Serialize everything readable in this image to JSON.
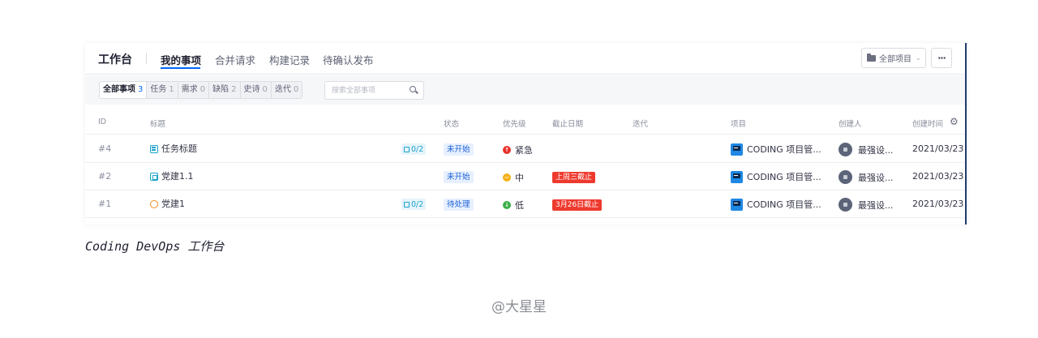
{
  "workspace_title": "工作台",
  "nav_tabs": [
    {
      "label": "我的事项",
      "active": true
    },
    {
      "label": "合并请求",
      "active": false
    },
    {
      "label": "构建记录",
      "active": false
    },
    {
      "label": "待确认发布",
      "active": false
    }
  ],
  "project_filter": {
    "label": "全部项目",
    "icon": "folder-icon"
  },
  "more_button": {
    "label": "···"
  },
  "segments": [
    {
      "label": "全部事项",
      "count": "3",
      "active": true
    },
    {
      "label": "任务",
      "count": "1"
    },
    {
      "label": "需求",
      "count": "0"
    },
    {
      "label": "缺陷",
      "count": "2"
    },
    {
      "label": "史诗",
      "count": "0"
    },
    {
      "label": "迭代",
      "count": "0"
    }
  ],
  "search": {
    "placeholder": "搜索全部事项"
  },
  "columns": {
    "id": "ID",
    "title": "标题",
    "status": "状态",
    "priority": "优先级",
    "due": "截止日期",
    "iteration": "迭代",
    "project": "项目",
    "creator": "创建人",
    "created": "创建时间"
  },
  "rows": [
    {
      "id": "#4",
      "type": "task",
      "title": "任务标题",
      "subtasks": "0/2",
      "status": "未开始",
      "priority": "紧急",
      "priority_color": "#e8312a",
      "due": "",
      "project": "CODING 项目管...",
      "creator": "最强设...",
      "created": "2021/03/23"
    },
    {
      "id": "#2",
      "type": "requirement",
      "title": "党建1.1",
      "subtasks": "",
      "status": "未开始",
      "priority": "中",
      "priority_color": "#f5b21b",
      "due": "上周三截止",
      "project": "CODING 项目管...",
      "creator": "最强设...",
      "created": "2021/03/23"
    },
    {
      "id": "#1",
      "type": "bug",
      "title": "党建1",
      "subtasks": "0/2",
      "status": "待处理",
      "priority": "低",
      "priority_color": "#3bb04a",
      "due": "3月26日截止",
      "project": "CODING 项目管...",
      "creator": "最强设...",
      "created": "2021/03/23"
    }
  ],
  "caption": "Coding DevOps 工作台",
  "watermark": "@大星星"
}
